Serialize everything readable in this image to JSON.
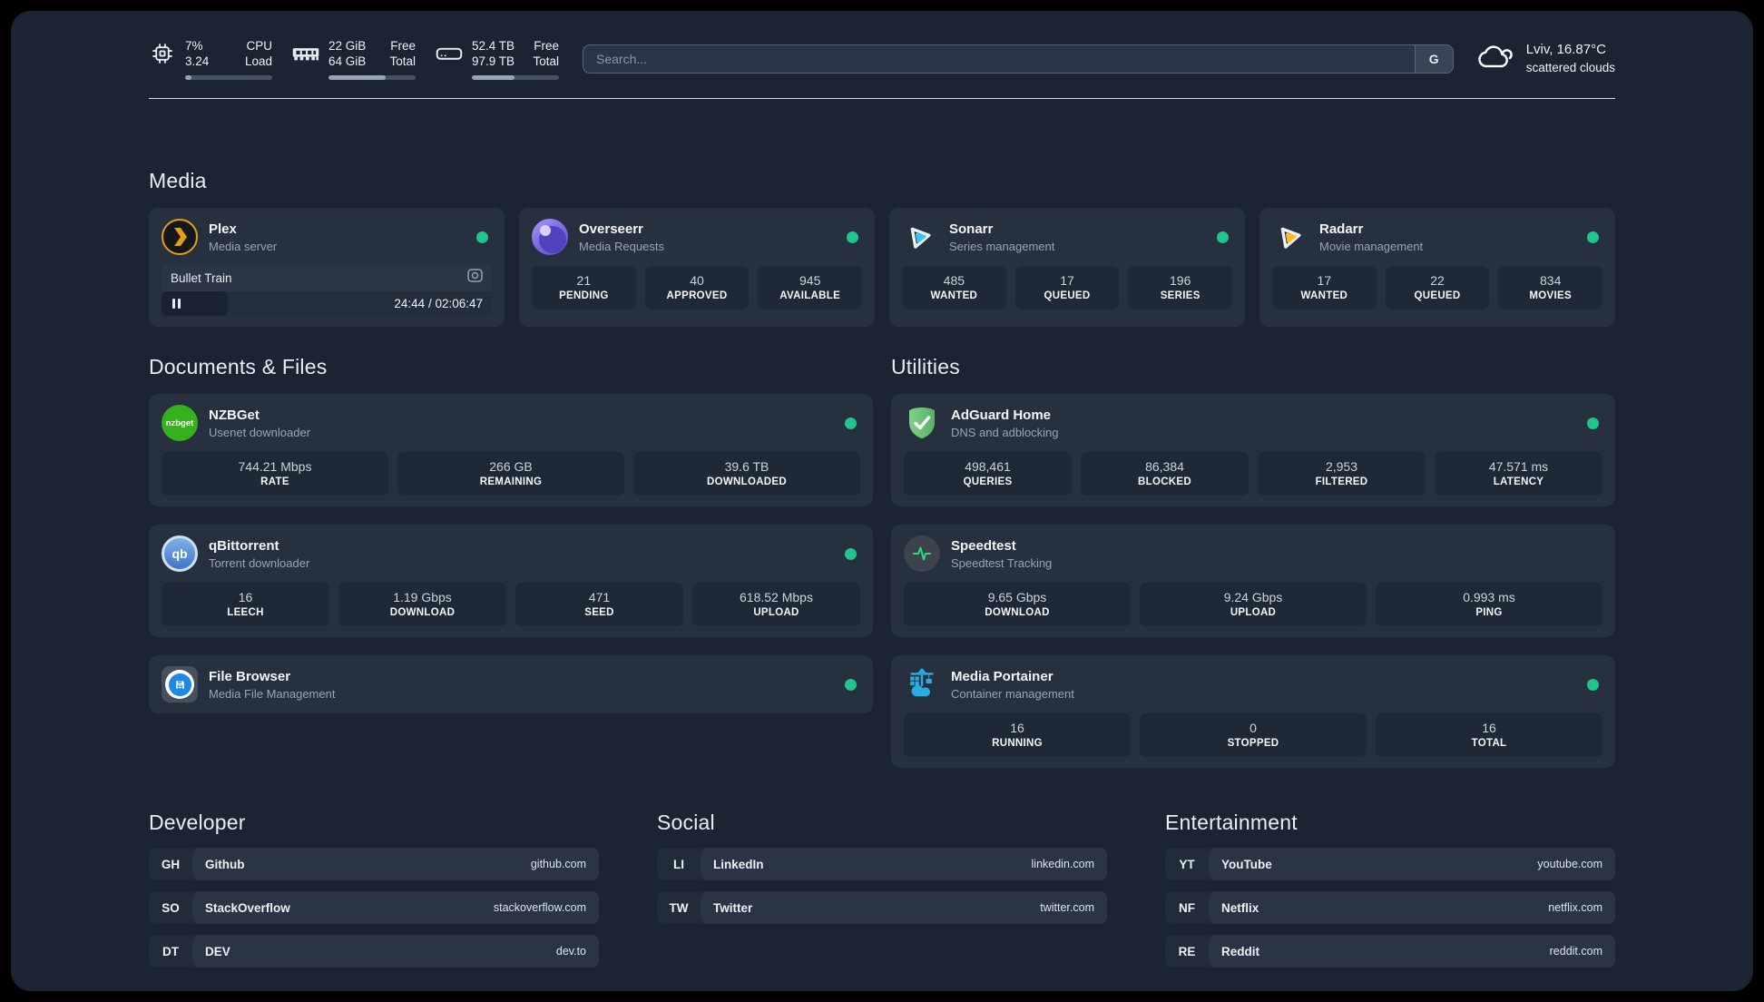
{
  "header": {
    "system_stats": [
      {
        "icon": "cpu-chip-icon",
        "values": [
          "7%",
          "3.24"
        ],
        "labels": [
          "CPU",
          "Load"
        ],
        "progress_percent": 7
      },
      {
        "icon": "ram-icon",
        "values": [
          "22 GiB",
          "64 GiB"
        ],
        "labels": [
          "Free",
          "Total"
        ],
        "progress_percent": 66
      },
      {
        "icon": "hard-drive-icon",
        "values": [
          "52.4 TB",
          "97.9 TB"
        ],
        "labels": [
          "Free",
          "Total"
        ],
        "progress_percent": 49
      }
    ],
    "search": {
      "placeholder": "Search...",
      "engine_button_label": "G"
    },
    "weather": {
      "icon": "scattered-clouds-icon",
      "location_temperature": "Lviv, 16.87°C",
      "condition": "scattered clouds"
    }
  },
  "sections": {
    "media": {
      "title": "Media",
      "apps": [
        {
          "icon": "plex-icon",
          "name": "Plex",
          "description": "Media server",
          "status": "online",
          "now_playing": {
            "title": "Bullet Train",
            "time": "24:44 / 02:06:47",
            "progress_percent": 20,
            "state": "paused"
          }
        },
        {
          "icon": "overseerr-icon",
          "name": "Overseerr",
          "description": "Media Requests",
          "status": "online",
          "stats": [
            {
              "value": "21",
              "label": "PENDING"
            },
            {
              "value": "40",
              "label": "APPROVED"
            },
            {
              "value": "945",
              "label": "AVAILABLE"
            }
          ]
        },
        {
          "icon": "sonarr-icon",
          "name": "Sonarr",
          "description": "Series management",
          "status": "online",
          "stats": [
            {
              "value": "485",
              "label": "WANTED"
            },
            {
              "value": "17",
              "label": "QUEUED"
            },
            {
              "value": "196",
              "label": "SERIES"
            }
          ]
        },
        {
          "icon": "radarr-icon",
          "name": "Radarr",
          "description": "Movie management",
          "status": "online",
          "stats": [
            {
              "value": "17",
              "label": "WANTED"
            },
            {
              "value": "22",
              "label": "QUEUED"
            },
            {
              "value": "834",
              "label": "MOVIES"
            }
          ]
        }
      ]
    },
    "documents": {
      "title": "Documents & Files",
      "apps": [
        {
          "icon": "nzbget-icon",
          "name": "NZBGet",
          "description": "Usenet downloader",
          "status": "online",
          "icon_text": "nzbget",
          "stats": [
            {
              "value": "744.21 Mbps",
              "label": "RATE"
            },
            {
              "value": "266 GB",
              "label": "REMAINING"
            },
            {
              "value": "39.6 TB",
              "label": "DOWNLOADED"
            }
          ]
        },
        {
          "icon": "qbittorrent-icon",
          "name": "qBittorrent",
          "description": "Torrent downloader",
          "status": "online",
          "icon_text": "qb",
          "stats": [
            {
              "value": "16",
              "label": "LEECH"
            },
            {
              "value": "1.19 Gbps",
              "label": "DOWNLOAD"
            },
            {
              "value": "471",
              "label": "SEED"
            },
            {
              "value": "618.52 Mbps",
              "label": "UPLOAD"
            }
          ]
        },
        {
          "icon": "filebrowser-icon",
          "name": "File Browser",
          "description": "Media File Management",
          "status": "online"
        }
      ]
    },
    "utilities": {
      "title": "Utilities",
      "apps": [
        {
          "icon": "adguard-icon",
          "name": "AdGuard Home",
          "description": "DNS and adblocking",
          "status": "online",
          "stats": [
            {
              "value": "498,461",
              "label": "QUERIES"
            },
            {
              "value": "86,384",
              "label": "BLOCKED"
            },
            {
              "value": "2,953",
              "label": "FILTERED"
            },
            {
              "value": "47.571 ms",
              "label": "LATENCY"
            }
          ]
        },
        {
          "icon": "speedtest-icon",
          "name": "Speedtest",
          "description": "Speedtest Tracking",
          "stats": [
            {
              "value": "9.65 Gbps",
              "label": "DOWNLOAD"
            },
            {
              "value": "9.24 Gbps",
              "label": "UPLOAD"
            },
            {
              "value": "0.993 ms",
              "label": "PING"
            }
          ]
        },
        {
          "icon": "portainer-icon",
          "name": "Media Portainer",
          "description": "Container management",
          "status": "online",
          "stats": [
            {
              "value": "16",
              "label": "RUNNING"
            },
            {
              "value": "0",
              "label": "STOPPED"
            },
            {
              "value": "16",
              "label": "TOTAL"
            }
          ]
        }
      ]
    }
  },
  "bookmarks": [
    {
      "title": "Developer",
      "links": [
        {
          "abbr": "GH",
          "name": "Github",
          "url": "github.com"
        },
        {
          "abbr": "SO",
          "name": "StackOverflow",
          "url": "stackoverflow.com"
        },
        {
          "abbr": "DT",
          "name": "DEV",
          "url": "dev.to"
        }
      ]
    },
    {
      "title": "Social",
      "links": [
        {
          "abbr": "LI",
          "name": "LinkedIn",
          "url": "linkedin.com"
        },
        {
          "abbr": "TW",
          "name": "Twitter",
          "url": "twitter.com"
        }
      ]
    },
    {
      "title": "Entertainment",
      "links": [
        {
          "abbr": "YT",
          "name": "YouTube",
          "url": "youtube.com"
        },
        {
          "abbr": "NF",
          "name": "Netflix",
          "url": "netflix.com"
        },
        {
          "abbr": "RE",
          "name": "Reddit",
          "url": "reddit.com"
        }
      ]
    }
  ],
  "colors": {
    "page_background": "#1c2433",
    "card_background": "#27303f",
    "stat_box_background": "#1f2836",
    "status_online": "#21c58c",
    "plex_accent": "#e5a00d",
    "overseerr_accent": "#8678ea",
    "sonarr_accent": "#38c6f4",
    "radarr_accent": "#ffb923",
    "nzbget_accent": "#36b11e",
    "qbittorrent_accent": "#4584d6",
    "filebrowser_accent": "#1e88e5",
    "adguard_accent": "#68bd71",
    "speedtest_accent": "#2fd980",
    "portainer_accent": "#2aabe2"
  }
}
